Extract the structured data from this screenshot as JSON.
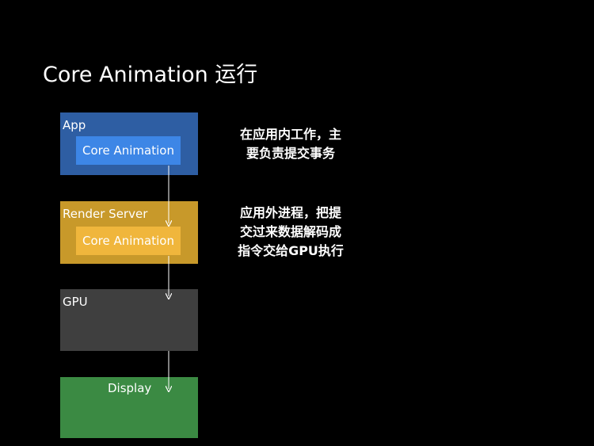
{
  "title": "Core Animation 运行",
  "boxes": {
    "app": {
      "label": "App",
      "inner_label": "Core Animation",
      "color": "#2e5ea3",
      "inner_color": "#3d86e6"
    },
    "render_server": {
      "label": "Render Server",
      "inner_label": "Core Animation",
      "color": "#c8992a",
      "inner_color": "#f0b63c"
    },
    "gpu": {
      "label": "GPU",
      "color": "#3f3f3f"
    },
    "display": {
      "label": "Display",
      "color": "#3b8a43"
    }
  },
  "notes": {
    "app": "在应用内工作，主\n要负责提交事务",
    "render_server": "应用外进程，把提\n交过来数据解码成\n指令交给GPU执行"
  },
  "colors": {
    "background": "#000000",
    "text": "#ffffff",
    "arrow": "#ffffff"
  }
}
